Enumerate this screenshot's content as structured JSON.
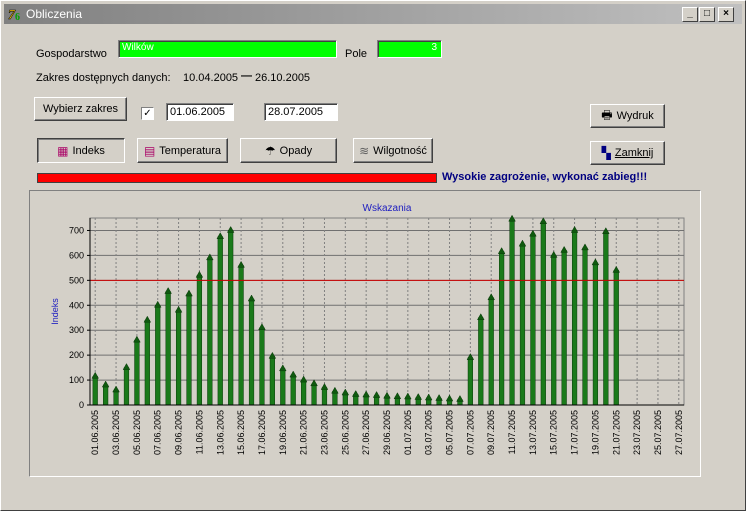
{
  "window": {
    "title": "Obliczenia",
    "icon": "app-icon"
  },
  "header": {
    "gospodarstwo_label": "Gospodarstwo",
    "gospodarstwo_value": "Wilków",
    "pole_label": "Pole",
    "pole_value": "3",
    "range_label": "Zakres dostępnych danych:",
    "range_from": "10.04.2005",
    "range_sep": "—",
    "range_to": "26.10.2005"
  },
  "controls": {
    "select_range": "Wybierz zakres",
    "checkbox_checked": true,
    "date_from": "01.06.2005",
    "date_to": "28.07.2005",
    "print": "Wydruk",
    "close": "Zamknij"
  },
  "tabs": [
    {
      "label": "Indeks",
      "icon": "chart-icon",
      "active": true
    },
    {
      "label": "Temperatura",
      "icon": "temperature-chart-icon",
      "active": false
    },
    {
      "label": "Opady",
      "icon": "umbrella-icon",
      "active": false
    },
    {
      "label": "Wilgotność",
      "icon": "humidity-icon",
      "active": false
    }
  ],
  "status": {
    "level": "high",
    "bar_color": "#ff0000",
    "message": "Wysokie zagrożenie, wykonać zabieg!!!"
  },
  "chart_data": {
    "type": "bar",
    "title": "Wskazania",
    "xlabel": "",
    "ylabel": "Indeks",
    "ylim": [
      0,
      750
    ],
    "yticks": [
      0,
      100,
      200,
      300,
      400,
      500,
      600,
      700
    ],
    "threshold": 500,
    "grid": true,
    "bar_color": "#1a7a1a",
    "threshold_color": "#cc0000",
    "categories": [
      "01.06.2005",
      "02.06.2005",
      "03.06.2005",
      "04.06.2005",
      "05.06.2005",
      "06.06.2005",
      "07.06.2005",
      "08.06.2005",
      "09.06.2005",
      "10.06.2005",
      "11.06.2005",
      "12.06.2005",
      "13.06.2005",
      "14.06.2005",
      "15.06.2005",
      "16.06.2005",
      "17.06.2005",
      "18.06.2005",
      "19.06.2005",
      "20.06.2005",
      "21.06.2005",
      "22.06.2005",
      "23.06.2005",
      "24.06.2005",
      "25.06.2005",
      "26.06.2005",
      "27.06.2005",
      "28.06.2005",
      "29.06.2005",
      "30.06.2005",
      "01.07.2005",
      "02.07.2005",
      "03.07.2005",
      "04.07.2005",
      "05.07.2005",
      "06.07.2005",
      "07.07.2005",
      "08.07.2005",
      "09.07.2005",
      "10.07.2005",
      "11.07.2005",
      "12.07.2005",
      "13.07.2005",
      "14.07.2005",
      "15.07.2005",
      "16.07.2005",
      "17.07.2005",
      "18.07.2005",
      "19.07.2005",
      "20.07.2005",
      "21.07.2005",
      "22.07.2005",
      "23.07.2005",
      "24.07.2005",
      "25.07.2005",
      "26.07.2005",
      "27.07.2005"
    ],
    "xtick_labels": [
      "01.06.2005",
      "03.06.2005",
      "05.06.2005",
      "07.06.2005",
      "09.06.2005",
      "11.06.2005",
      "13.06.2005",
      "15.06.2005",
      "17.06.2005",
      "19.06.2005",
      "21.06.2005",
      "23.06.2005",
      "25.06.2005",
      "27.06.2005",
      "29.06.2005",
      "01.07.2005",
      "03.07.2005",
      "05.07.2005",
      "07.07.2005",
      "09.07.2005",
      "11.07.2005",
      "13.07.2005",
      "15.07.2005",
      "17.07.2005",
      "19.07.2005",
      "21.07.2005",
      "23.07.2005",
      "25.07.2005",
      "27.07.2005"
    ],
    "values": [
      115,
      80,
      60,
      150,
      260,
      340,
      400,
      455,
      380,
      445,
      520,
      590,
      675,
      700,
      560,
      425,
      310,
      195,
      145,
      120,
      100,
      85,
      70,
      55,
      48,
      42,
      40,
      38,
      35,
      33,
      32,
      30,
      28,
      26,
      24,
      22,
      190,
      350,
      430,
      615,
      745,
      645,
      685,
      735,
      600,
      620,
      700,
      630,
      570,
      695,
      540,
      0,
      0,
      0,
      0,
      0,
      0
    ]
  }
}
